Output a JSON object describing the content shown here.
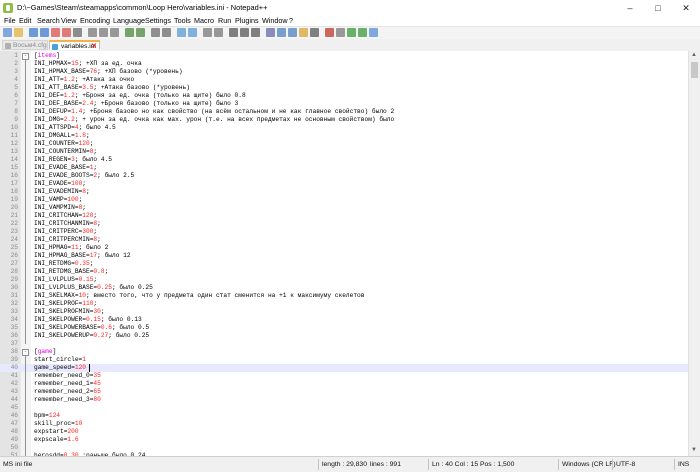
{
  "window": {
    "title": "D:\\~Games\\Steam\\steamapps\\common\\Loop Hero\\variables.ini - Notepad++",
    "minimize_icon": "minimize-icon",
    "maximize_icon": "maximize-icon",
    "close_icon": "close-icon"
  },
  "menu": [
    "File",
    "Edit",
    "Search",
    "View",
    "Encoding",
    "Language",
    "Settings",
    "Tools",
    "Macro",
    "Run",
    "Plugins",
    "Window",
    "?"
  ],
  "toolbar_icons": [
    "new-file-icon",
    "open-file-icon",
    "save-icon",
    "save-all-icon",
    "close-file-icon",
    "close-all-icon",
    "print-icon",
    "cut-icon",
    "copy-icon",
    "paste-icon",
    "undo-icon",
    "redo-icon",
    "find-icon",
    "replace-icon",
    "zoom-in-icon",
    "zoom-out-icon",
    "sync-vertical-icon",
    "sync-horizontal-icon",
    "word-wrap-icon",
    "show-all-chars-icon",
    "indent-guide-icon",
    "language-icon",
    "doc-map-icon",
    "function-list-icon",
    "folder-workspace-icon",
    "monitor-icon",
    "record-macro-icon",
    "stop-macro-icon",
    "play-macro-icon",
    "run-macro-multiple-icon",
    "save-macro-icon"
  ],
  "tabs": [
    {
      "label": "Восьм4.cfg",
      "active": false
    },
    {
      "label": "variables.ini",
      "active": true
    }
  ],
  "lines": [
    {
      "n": "1",
      "s": "[items]",
      "fold": "-"
    },
    {
      "n": "2",
      "k": "INI_HPMAX=",
      "v": "15",
      "c": "; +ХП за ед. очка"
    },
    {
      "n": "3",
      "k": "INI_HPMAX_BASE=",
      "v": "76",
      "c": "; +ХП базово (*уровень)"
    },
    {
      "n": "4",
      "k": "INI_ATT=",
      "v": "1.2",
      "c": "; +Атака за очко"
    },
    {
      "n": "5",
      "k": "INI_ATT_BASE=",
      "v": "3.5",
      "c": "; +Атака базово (*уровень)"
    },
    {
      "n": "6",
      "k": "INI_DEF=",
      "v": "1.2",
      "c": "; +Броня за ед. очка (только на щите) было 0.8"
    },
    {
      "n": "7",
      "k": "INI_DEF_BASE=",
      "v": "2.4",
      "c": "; +Броня базово (только на щите) было 3"
    },
    {
      "n": "8",
      "k": "INI_DEFUP=",
      "v": "1.4",
      "c": "; +Броня базово но как свойство (на всём остальном и не как главное свойство) было 2"
    },
    {
      "n": "9",
      "k": "INI_DMG=",
      "v": "2.2",
      "c": "; + урон за ед. очка как мах. урон (т.е. на всех предметах не основным свойством) было"
    },
    {
      "n": "10",
      "k": "INI_ATTSPD=",
      "v": "4",
      "c": "; было 4.5"
    },
    {
      "n": "11",
      "k": "INI_DMGALL=",
      "v": "1.8",
      "c": ";"
    },
    {
      "n": "12",
      "k": "INI_COUNTER=",
      "v": "120",
      "c": ";"
    },
    {
      "n": "13",
      "k": "INI_COUNTERMIN=",
      "v": "8",
      "c": ";"
    },
    {
      "n": "14",
      "k": "INI_REGEN=",
      "v": "3",
      "c": "; было 4.5"
    },
    {
      "n": "15",
      "k": "INI_EVADE_BASE=",
      "v": "1",
      "c": ";"
    },
    {
      "n": "16",
      "k": "INI_EVADE_BOOTS=",
      "v": "2",
      "c": "; было 2.5"
    },
    {
      "n": "17",
      "k": "INI_EVADE=",
      "v": "100",
      "c": ";"
    },
    {
      "n": "18",
      "k": "INI_EVADEMIN=",
      "v": "8",
      "c": ";"
    },
    {
      "n": "19",
      "k": "INI_VAMP=",
      "v": "100",
      "c": ";"
    },
    {
      "n": "20",
      "k": "INI_VAMPMIN=",
      "v": "8",
      "c": ";"
    },
    {
      "n": "21",
      "k": "INI_CRITCHAN=",
      "v": "120",
      "c": ";"
    },
    {
      "n": "22",
      "k": "INI_CRITCHANMIN=",
      "v": "8",
      "c": ";"
    },
    {
      "n": "23",
      "k": "INI_CRITPERC=",
      "v": "300",
      "c": ";"
    },
    {
      "n": "24",
      "k": "INI_CRITPERCMIN=",
      "v": "8",
      "c": ";"
    },
    {
      "n": "25",
      "k": "INI_HPMAG=",
      "v": "11",
      "c": "; было 2"
    },
    {
      "n": "26",
      "k": "INI_HPMAG_BASE=",
      "v": "17",
      "c": "; было 12"
    },
    {
      "n": "27",
      "k": "INI_RETDMG=",
      "v": "0.35",
      "c": ";"
    },
    {
      "n": "28",
      "k": "INI_RETDMG_BASE=",
      "v": "0.8",
      "c": ";"
    },
    {
      "n": "29",
      "k": "INI_LVLPLUS=",
      "v": "0.15",
      "c": ";"
    },
    {
      "n": "30",
      "k": "INI_LVLPLUS_BASE=",
      "v": "0.25",
      "c": "; было 0.25"
    },
    {
      "n": "31",
      "k": "INI_SKELMAX=",
      "v": "10",
      "c": "; вместо того, что у предмета один стат сменится на +1 к максимуму скелетов"
    },
    {
      "n": "32",
      "k": "INI_SKELPROF=",
      "v": "110",
      "c": ";"
    },
    {
      "n": "33",
      "k": "INI_SKELPROFMIN=",
      "v": "30",
      "c": ";"
    },
    {
      "n": "34",
      "k": "INI_SKELPOWER=",
      "v": "0.15",
      "c": "; было 0.13"
    },
    {
      "n": "35",
      "k": "INI_SKELPOWERBASE=",
      "v": "0.6",
      "c": "; было 0.5"
    },
    {
      "n": "36",
      "k": "INI_SKELPOWERUP=",
      "v": "0.27",
      "c": "; было 0.25"
    },
    {
      "n": "37",
      "k": "",
      "v": "",
      "c": ""
    },
    {
      "n": "38",
      "s": "[game]",
      "fold": "-"
    },
    {
      "n": "39",
      "k": "start_circle=",
      "v": "1",
      "c": ""
    },
    {
      "n": "40",
      "k": "game_speed=",
      "v": "120",
      "c": "",
      "current": true
    },
    {
      "n": "41",
      "k": "remember_need_0=",
      "v": "35",
      "c": ""
    },
    {
      "n": "42",
      "k": "remember_need_1=",
      "v": "45",
      "c": ""
    },
    {
      "n": "43",
      "k": "remember_need_2=",
      "v": "65",
      "c": ""
    },
    {
      "n": "44",
      "k": "remember_need_3=",
      "v": "80",
      "c": ""
    },
    {
      "n": "45",
      "k": "",
      "v": "",
      "c": ""
    },
    {
      "n": "46",
      "k": "bpm=",
      "v": "124",
      "c": ""
    },
    {
      "n": "47",
      "k": "skill_proc=",
      "v": "10",
      "c": ""
    },
    {
      "n": "48",
      "k": "expstart=",
      "v": "200",
      "c": ""
    },
    {
      "n": "49",
      "k": "expscale=",
      "v": "1.6",
      "c": ""
    },
    {
      "n": "50",
      "k": "",
      "v": "",
      "c": ""
    },
    {
      "n": "51",
      "k": "herosdd=",
      "v": "0.30",
      "c": " ;раньше было 0.24"
    }
  ],
  "status": {
    "file_type": "MS ini file",
    "length": "length : 29,830",
    "lines": "lines : 991",
    "position": "Ln : 40   Col : 15   Pos : 1,500",
    "eol": "Windows (CR LF)",
    "encoding": "UTF-8",
    "mode": "INS"
  },
  "colors": {
    "section": "#e000e0",
    "value": "#ff2020",
    "current_line": "#e8e8ff",
    "tab_accent": "#f3b14b"
  }
}
